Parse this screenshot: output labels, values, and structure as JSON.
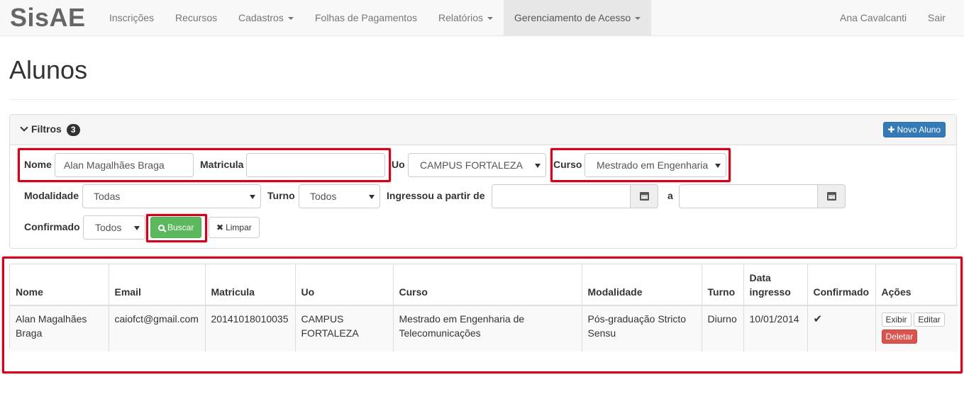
{
  "brand": "SisAE",
  "nav": {
    "items": [
      {
        "label": "Inscrições",
        "dropdown": false
      },
      {
        "label": "Recursos",
        "dropdown": false
      },
      {
        "label": "Cadastros",
        "dropdown": true
      },
      {
        "label": "Folhas de Pagamentos",
        "dropdown": false
      },
      {
        "label": "Relatórios",
        "dropdown": true
      },
      {
        "label": "Gerenciamento de Acesso",
        "dropdown": true,
        "active": true
      }
    ],
    "user": "Ana Cavalcanti",
    "logout": "Sair"
  },
  "page": {
    "title": "Alunos"
  },
  "filters": {
    "title": "Filtros",
    "count": "3",
    "new_button": "Novo Aluno",
    "nome": {
      "label": "Nome",
      "value": "Alan Magalhães Braga"
    },
    "matricula": {
      "label": "Matricula",
      "value": ""
    },
    "uo": {
      "label": "Uo",
      "value": "CAMPUS FORTALEZA"
    },
    "curso": {
      "label": "Curso",
      "value": "Mestrado em Engenharia"
    },
    "modalidade": {
      "label": "Modalidade",
      "value": "Todas"
    },
    "turno": {
      "label": "Turno",
      "value": "Todos"
    },
    "ingressou": {
      "label": "Ingressou a partir de",
      "from": "",
      "to_label": "a",
      "to": ""
    },
    "confirmado": {
      "label": "Confirmado",
      "value": "Todos"
    },
    "buscar": "Buscar",
    "limpar": "Limpar"
  },
  "table": {
    "headers": [
      "Nome",
      "Email",
      "Matricula",
      "Uo",
      "Curso",
      "Modalidade",
      "Turno",
      "Data ingresso",
      "Confirmado",
      "Ações"
    ],
    "rows": [
      {
        "nome": "Alan Magalhães Braga",
        "email": "caiofct@gmail.com",
        "matricula": "20141018010035",
        "uo": "CAMPUS FORTALEZA",
        "curso": "Mestrado em Engenharia de Telecomunicações",
        "modalidade": "Pós-graduação Stricto Sensu",
        "turno": "Diurno",
        "data_ingresso": "10/01/2014",
        "confirmado": "✔",
        "actions": {
          "exibir": "Exibir",
          "editar": "Editar",
          "deletar": "Deletar"
        }
      }
    ]
  },
  "colors": {
    "highlight": "#d0021b",
    "primary": "#337ab7",
    "success": "#5cb85c",
    "danger": "#d9534f"
  }
}
